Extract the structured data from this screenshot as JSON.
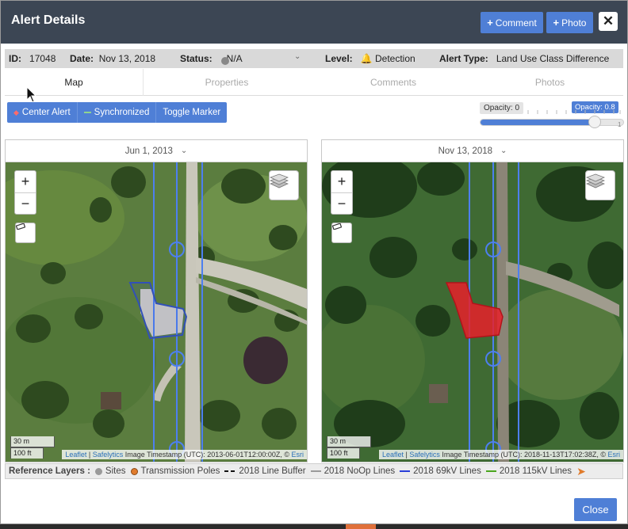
{
  "header": {
    "title": "Alert Details",
    "comment_label": "Comment",
    "photo_label": "Photo",
    "close_icon": "close-icon"
  },
  "info": {
    "id_label": "ID:",
    "id_value": "17048",
    "date_label": "Date:",
    "date_value": "Nov 13, 2018",
    "status_label": "Status:",
    "status_value": "N/A",
    "level_label": "Level:",
    "level_value": "Detection",
    "alert_type_label": "Alert Type:",
    "alert_type_value": "Land Use Class Difference"
  },
  "tabs": [
    {
      "label": "Map",
      "active": true
    },
    {
      "label": "Properties",
      "active": false
    },
    {
      "label": "Comments",
      "active": false
    },
    {
      "label": "Photos",
      "active": false
    }
  ],
  "toolbar": {
    "center_alert": "Center Alert",
    "synchronized": "Synchronized",
    "toggle_marker": "Toggle Marker"
  },
  "opacity": {
    "min_label": "Opacity: 0",
    "current_label": "Opacity: 0.8",
    "value": 0.8,
    "max_tick": "1"
  },
  "maps": [
    {
      "date": "Jun 1, 2013",
      "scale_m": "30 m",
      "scale_ft": "100 ft",
      "attribution_leaflet": "Leaflet",
      "attribution_sep": "|",
      "attribution_safe": "Safelytics",
      "attribution_text": "Image Timestamp (UTC): 2013-06-01T12:00:00Z, ©",
      "attribution_esri": "Esri"
    },
    {
      "date": "Nov 13, 2018",
      "scale_m": "30 m",
      "scale_ft": "100 ft",
      "attribution_leaflet": "Leaflet",
      "attribution_sep": "|",
      "attribution_safe": "Safelytics",
      "attribution_text": "Image Timestamp (UTC): 2018-11-13T17:02:38Z, ©",
      "attribution_esri": "Esri"
    }
  ],
  "legend": {
    "title": "Reference Layers :",
    "items": [
      {
        "label": "Sites",
        "color": "#9a9a9a"
      },
      {
        "label": "Transmission Poles",
        "color": "#e07b2c"
      },
      {
        "label": "2018 Line Buffer",
        "color": "#111111"
      },
      {
        "label": "2018 NoOp Lines",
        "color": "#9a9a9a"
      },
      {
        "label": "2018 69kV Lines",
        "color": "#2a3fd8"
      },
      {
        "label": "2018 115kV Lines",
        "color": "#4aa61e"
      }
    ]
  },
  "footer": {
    "close_label": "Close"
  },
  "colors": {
    "header_bg": "#3c4654",
    "accent": "#4f7fd6",
    "line_blue": "#4d7ff0",
    "alert_red": "#e8202a"
  }
}
